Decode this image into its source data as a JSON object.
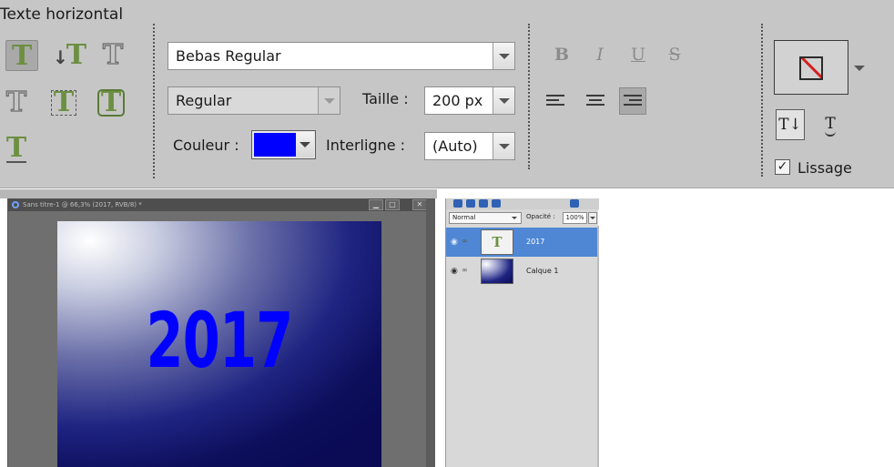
{
  "options_bar": {
    "title": "Texte horizontal",
    "font_family": "Bebas Regular",
    "font_style": "Regular",
    "size_label": "Taille :",
    "size_value": "200 px",
    "color_label": "Couleur :",
    "color_value": "#0000ff",
    "leading_label": "Interligne :",
    "leading_value": "(Auto)",
    "format_buttons": [
      "B",
      "I",
      "U",
      "S"
    ],
    "text_direction_glyph": "T↓",
    "text_warp_glyph": "T",
    "antialias_label": "Lissage",
    "antialias_checked": true,
    "type_tool_glyph": "T",
    "type_tool_icons": [
      "horizontal-type-icon",
      "vertical-type-icon",
      "horizontal-type-mask-icon",
      "vertical-type-mask-icon",
      "type-on-selection-icon",
      "type-on-shape-icon",
      "type-on-path-icon"
    ]
  },
  "document": {
    "tab_title": "Sans titre-1 @ 66,3% (2017, RVB/8) *",
    "canvas_text": "2017",
    "text_color": "#0000ff",
    "window_buttons": [
      "▁",
      "□",
      "✕"
    ]
  },
  "layers_panel": {
    "blend_mode": "Normal",
    "opacity_label": "Opacité :",
    "opacity_value": "100%",
    "layers": [
      {
        "name": "2017",
        "type": "text",
        "selected": true
      },
      {
        "name": "Calque 1",
        "type": "image",
        "selected": false
      }
    ]
  }
}
